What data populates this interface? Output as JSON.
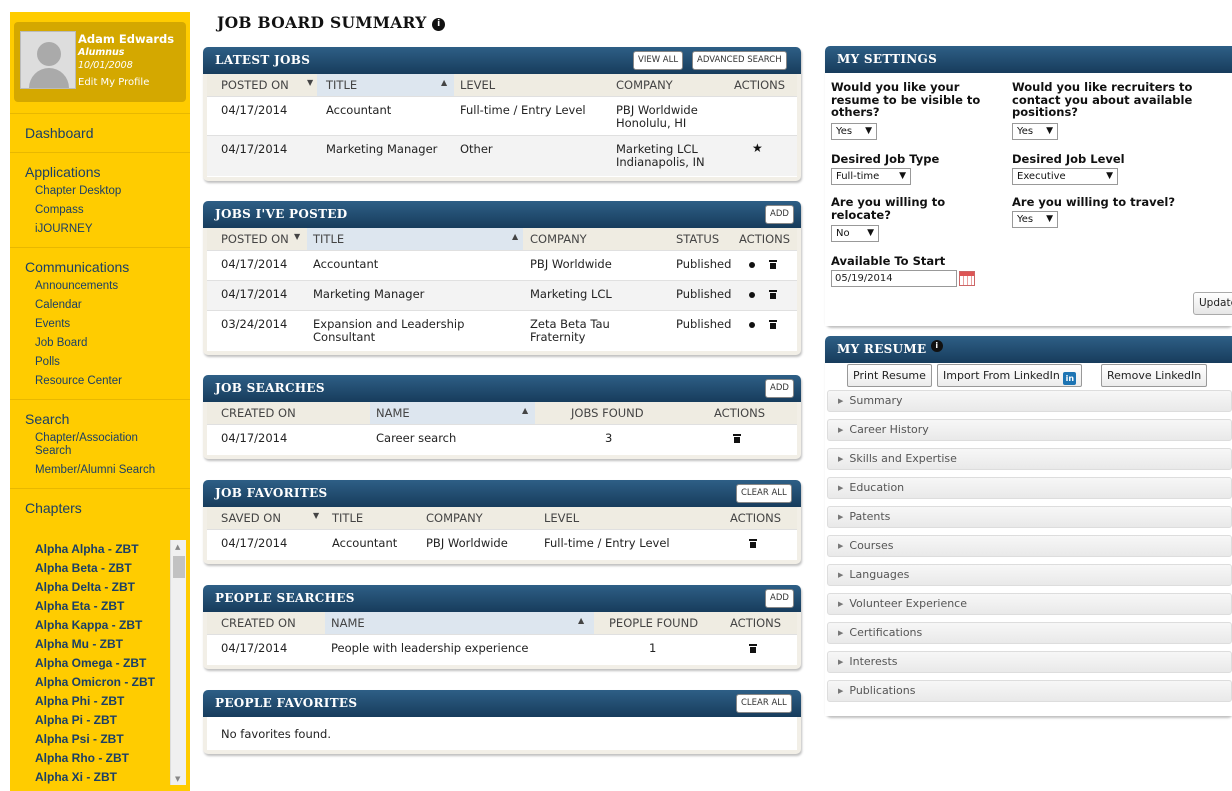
{
  "profile": {
    "name": "Adam Edwards",
    "role": "Alumnus",
    "date": "10/01/2008",
    "edit_label": "Edit My Profile"
  },
  "nav": {
    "dashboard": "Dashboard",
    "applications": {
      "heading": "Applications",
      "items": [
        "Chapter Desktop",
        "Compass",
        "iJOURNEY"
      ]
    },
    "communications": {
      "heading": "Communications",
      "items": [
        "Announcements",
        "Calendar",
        "Events",
        "Job Board",
        "Polls",
        "Resource Center"
      ]
    },
    "search": {
      "heading": "Search",
      "items": [
        "Chapter/Association Search",
        "Member/Alumni Search"
      ]
    },
    "chapters": {
      "heading": "Chapters",
      "items": [
        "Alpha Alpha - ZBT",
        "Alpha Beta - ZBT",
        "Alpha Delta - ZBT",
        "Alpha Eta - ZBT",
        "Alpha Kappa - ZBT",
        "Alpha Mu - ZBT",
        "Alpha Omega - ZBT",
        "Alpha Omicron - ZBT",
        "Alpha Phi - ZBT",
        "Alpha Pi - ZBT",
        "Alpha Psi - ZBT",
        "Alpha Rho - ZBT",
        "Alpha Xi - ZBT"
      ]
    }
  },
  "page_title": "JOB BOARD SUMMARY",
  "latest_jobs": {
    "title": "LATEST JOBS",
    "view_all": "VIEW ALL",
    "advanced_search": "ADVANCED SEARCH",
    "columns": [
      "POSTED ON",
      "TITLE",
      "LEVEL",
      "COMPANY",
      "ACTIONS"
    ],
    "rows": [
      {
        "posted": "04/17/2014",
        "title": "Accountant",
        "level": "Full-time / Entry Level",
        "company": "PBJ Worldwide",
        "location": "Honolulu, HI"
      },
      {
        "posted": "04/17/2014",
        "title": "Marketing Manager",
        "level": "Other",
        "company": "Marketing LCL",
        "location": "Indianapolis, IN"
      }
    ]
  },
  "jobs_posted": {
    "title": "JOBS I'VE POSTED",
    "add": "ADD",
    "columns": [
      "POSTED ON",
      "TITLE",
      "COMPANY",
      "STATUS",
      "ACTIONS"
    ],
    "rows": [
      {
        "posted": "04/17/2014",
        "title": "Accountant",
        "title2": "",
        "company": "PBJ Worldwide",
        "company2": "",
        "status": "Published"
      },
      {
        "posted": "04/17/2014",
        "title": "Marketing Manager",
        "title2": "",
        "company": "Marketing LCL",
        "company2": "",
        "status": "Published"
      },
      {
        "posted": "03/24/2014",
        "title": "Expansion and Leadership",
        "title2": "Consultant",
        "company": "Zeta Beta Tau",
        "company2": "Fraternity",
        "status": "Published"
      }
    ]
  },
  "job_searches": {
    "title": "JOB SEARCHES",
    "add": "ADD",
    "columns": [
      "CREATED ON",
      "NAME",
      "JOBS FOUND",
      "ACTIONS"
    ],
    "rows": [
      {
        "created": "04/17/2014",
        "name": "Career search",
        "found": "3"
      }
    ]
  },
  "job_favorites": {
    "title": "JOB FAVORITES",
    "clear": "CLEAR ALL",
    "columns": [
      "SAVED ON",
      "TITLE",
      "COMPANY",
      "LEVEL",
      "ACTIONS"
    ],
    "rows": [
      {
        "saved": "04/17/2014",
        "title": "Accountant",
        "company": "PBJ Worldwide",
        "level": "Full-time / Entry Level"
      }
    ]
  },
  "people_searches": {
    "title": "PEOPLE SEARCHES",
    "add": "ADD",
    "columns": [
      "CREATED ON",
      "NAME",
      "PEOPLE FOUND",
      "ACTIONS"
    ],
    "rows": [
      {
        "created": "04/17/2014",
        "name": "People with leadership experience",
        "found": "1"
      }
    ]
  },
  "people_favorites": {
    "title": "PEOPLE FAVORITES",
    "clear": "CLEAR ALL",
    "empty": "No favorites found."
  },
  "settings": {
    "title": "MY SETTINGS",
    "resume_visible": {
      "label": "Would you like your resume to be visible to others?",
      "value": "Yes"
    },
    "recruiters": {
      "label": "Would you like recruiters to contact you about available positions?",
      "value": "Yes"
    },
    "job_type": {
      "label": "Desired Job Type",
      "value": "Full-time"
    },
    "job_level": {
      "label": "Desired Job Level",
      "value": "Executive"
    },
    "relocate": {
      "label": "Are you willing to relocate?",
      "value": "No"
    },
    "travel": {
      "label": "Are you willing to travel?",
      "value": "Yes"
    },
    "start": {
      "label": "Available To Start",
      "value": "05/19/2014"
    },
    "update": "Update"
  },
  "resume": {
    "title": "MY RESUME",
    "print": "Print Resume",
    "import": "Import From LinkedIn",
    "linkedin_icon_text": "in",
    "remove": "Remove LinkedIn",
    "sections": [
      "Summary",
      "Career History",
      "Skills and Expertise",
      "Education",
      "Patents",
      "Courses",
      "Languages",
      "Volunteer Experience",
      "Certifications",
      "Interests",
      "Publications"
    ]
  }
}
